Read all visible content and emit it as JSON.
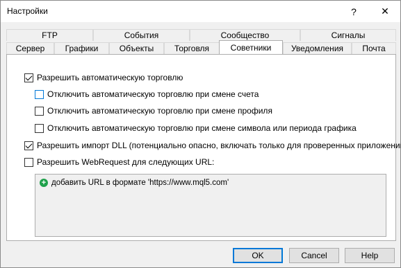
{
  "window": {
    "title": "Настройки",
    "help_glyph": "?",
    "close_glyph": "✕"
  },
  "tabs": {
    "top_row": [
      "FTP",
      "События",
      "Сообщество",
      "Сигналы"
    ],
    "bottom_row": [
      "Сервер",
      "Графики",
      "Объекты",
      "Торговля",
      "Советники",
      "Уведомления",
      "Почта"
    ],
    "active": "Советники"
  },
  "options": [
    {
      "label": "Разрешить автоматическую торговлю",
      "checked": true
    },
    {
      "label": "Отключить автоматическую торговлю при смене счета",
      "checked": false
    },
    {
      "label": "Отключить автоматическую торговлю при смене профиля",
      "checked": false
    },
    {
      "label": "Отключить автоматическую торговлю при смене символа или периода графика",
      "checked": false
    },
    {
      "label": "Разрешить импорт DLL (потенциально опасно, включать только для проверенных приложений)",
      "checked": true
    },
    {
      "label": "Разрешить WebRequest для следующих URL:",
      "checked": false
    }
  ],
  "url_list": {
    "add_label": "добавить URL в формате 'https://www.mql5.com'",
    "add_icon": "plus-icon"
  },
  "buttons": {
    "ok": "OK",
    "cancel": "Cancel",
    "help": "Help"
  }
}
